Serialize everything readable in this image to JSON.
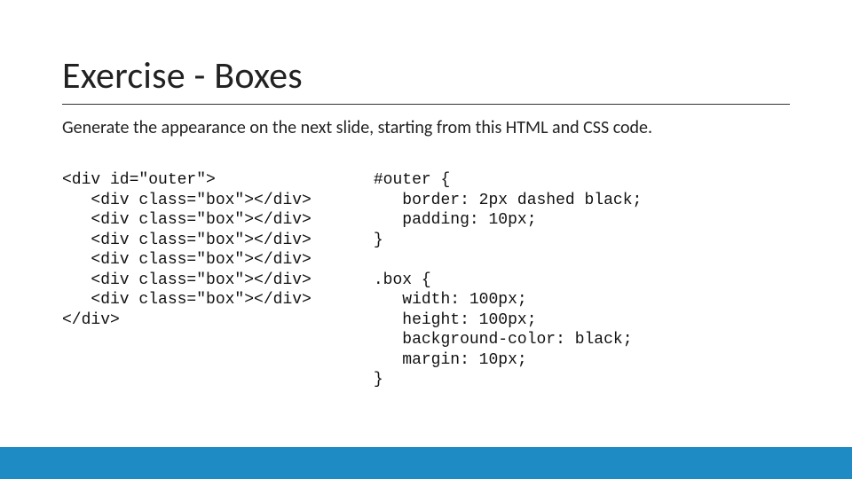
{
  "title": "Exercise - Boxes",
  "subtitle": "Generate the appearance on the next slide, starting from this HTML and CSS code.",
  "code_left": "<div id=\"outer\">\n   <div class=\"box\"></div>\n   <div class=\"box\"></div>\n   <div class=\"box\"></div>\n   <div class=\"box\"></div>\n   <div class=\"box\"></div>\n   <div class=\"box\"></div>\n</div>",
  "code_right": "#outer {\n   border: 2px dashed black;\n   padding: 10px;\n}\n\n.box {\n   width: 100px;\n   height: 100px;\n   background-color: black;\n   margin: 10px;\n}",
  "accent_color": "#1f8bc4"
}
